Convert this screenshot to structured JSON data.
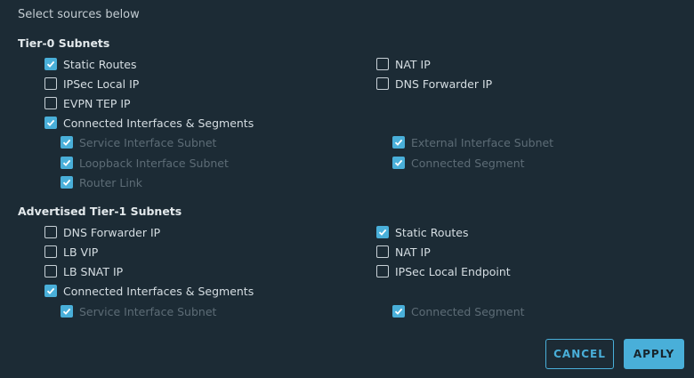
{
  "intro": "Select sources below",
  "tier0": {
    "title": "Tier-0 Subnets",
    "options": [
      {
        "label": "Static Routes",
        "checked": true,
        "disabled": false
      },
      {
        "label": "NAT IP",
        "checked": false,
        "disabled": false
      },
      {
        "label": "IPSec Local IP",
        "checked": false,
        "disabled": false
      },
      {
        "label": "DNS Forwarder IP",
        "checked": false,
        "disabled": false
      },
      {
        "label": "EVPN TEP IP",
        "checked": false,
        "disabled": false
      },
      {
        "label": "Connected Interfaces & Segments",
        "checked": true,
        "disabled": false
      },
      {
        "label": "Service Interface Subnet",
        "checked": true,
        "disabled": true
      },
      {
        "label": "External Interface Subnet",
        "checked": true,
        "disabled": true
      },
      {
        "label": "Loopback Interface Subnet",
        "checked": true,
        "disabled": true
      },
      {
        "label": "Connected Segment",
        "checked": true,
        "disabled": true
      },
      {
        "label": "Router Link",
        "checked": true,
        "disabled": true
      }
    ]
  },
  "tier1": {
    "title": "Advertised Tier-1 Subnets",
    "options": [
      {
        "label": "DNS Forwarder IP",
        "checked": false,
        "disabled": false
      },
      {
        "label": "Static Routes",
        "checked": true,
        "disabled": false
      },
      {
        "label": "LB VIP",
        "checked": false,
        "disabled": false
      },
      {
        "label": "NAT IP",
        "checked": false,
        "disabled": false
      },
      {
        "label": "LB SNAT IP",
        "checked": false,
        "disabled": false
      },
      {
        "label": "IPSec Local Endpoint",
        "checked": false,
        "disabled": false
      },
      {
        "label": "Connected Interfaces & Segments",
        "checked": true,
        "disabled": false
      },
      {
        "label": "Service Interface Subnet",
        "checked": true,
        "disabled": true
      },
      {
        "label": "Connected Segment",
        "checked": true,
        "disabled": true
      }
    ]
  },
  "buttons": {
    "cancel": "CANCEL",
    "apply": "APPLY"
  },
  "colors": {
    "background": "#1c2b35",
    "accent": "#49afd9",
    "disabled_text": "#5d6c76"
  }
}
